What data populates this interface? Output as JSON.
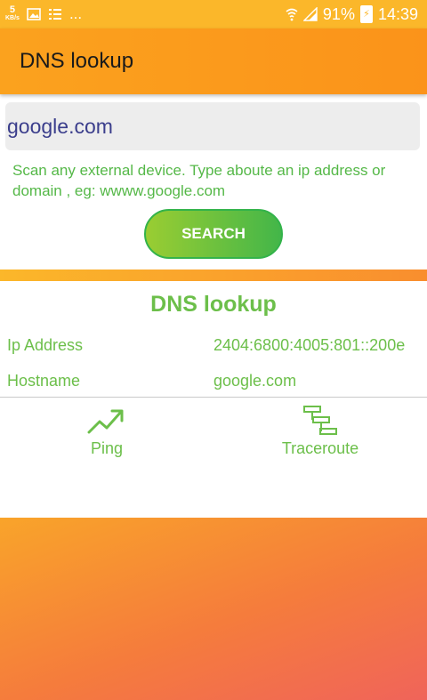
{
  "status_bar": {
    "net_speed_value": "5",
    "net_speed_unit": "KB/s",
    "overflow": "...",
    "battery": "91%",
    "time": "14:39"
  },
  "app_bar": {
    "title": "DNS lookup"
  },
  "search": {
    "value": "google.com",
    "help_text": "Scan any external device. Type aboute an ip address or domain , eg: wwww.google.com",
    "button_label": "SEARCH"
  },
  "result": {
    "title": "DNS lookup",
    "rows": [
      {
        "label": "Ip Address",
        "value": "2404:6800:4005:801::200e"
      },
      {
        "label": "Hostname",
        "value": "google.com"
      }
    ]
  },
  "tools": {
    "ping_label": "Ping",
    "traceroute_label": "Traceroute"
  },
  "icons": {
    "ping": "trending-up-icon",
    "traceroute": "hierarchy-icon"
  },
  "colors": {
    "status_bar": "#FBB72A",
    "app_bar": "#FB931A",
    "accent_green": "#6CBF4A",
    "help_green": "#55B848",
    "input_text": "#3B3E8C",
    "caret": "#E03A6A"
  }
}
